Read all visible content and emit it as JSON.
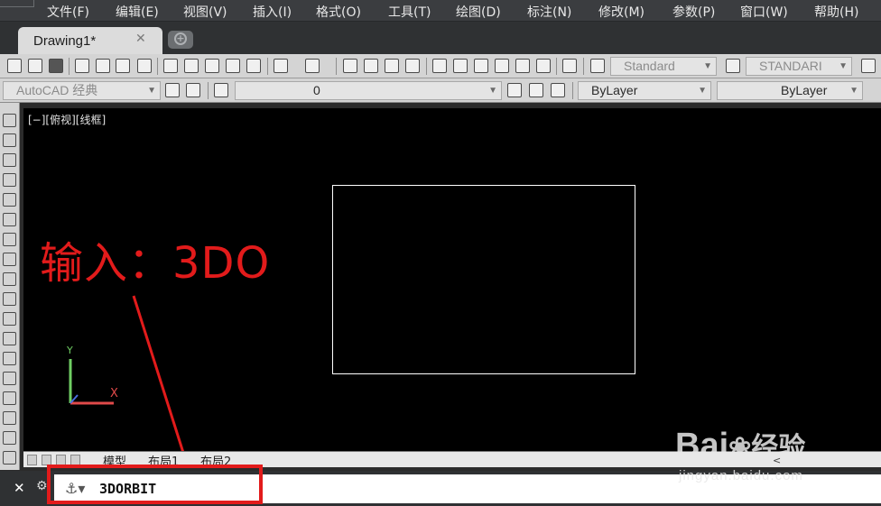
{
  "menubar": {
    "items": [
      "文件(F)",
      "编辑(E)",
      "视图(V)",
      "插入(I)",
      "格式(O)",
      "工具(T)",
      "绘图(D)",
      "标注(N)",
      "修改(M)",
      "参数(P)",
      "窗口(W)",
      "帮助(H)"
    ]
  },
  "tabs": {
    "active_label": "Drawing1*",
    "close_symbol": "✕",
    "new_tab_symbol": "+"
  },
  "toolbar1": {
    "text_style": "Standard",
    "dim_style": "STANDARI"
  },
  "toolbar2": {
    "workspace": "AutoCAD 经典",
    "layer": "0",
    "color": "ByLayer",
    "linetype": "ByLayer"
  },
  "viewport": {
    "label": "[−][俯视][线框]",
    "annotation": "输入：3DO",
    "ucs": {
      "y_label": "Y",
      "x_label": "X"
    },
    "annotation_color": "#e21b1b",
    "background": "#000000"
  },
  "layout_tabs": [
    "模型",
    "布局1",
    "布局2"
  ],
  "command_line": {
    "text": "3DORBIT",
    "close_symbol": "✕"
  },
  "watermark": {
    "brand": "Bai",
    "brand_cn": "经验",
    "url": "jingyan.baidu.com"
  },
  "colors": {
    "accent_red": "#e21b1b",
    "ucs_y": "#6fce63",
    "ucs_x": "#e14a4a"
  }
}
